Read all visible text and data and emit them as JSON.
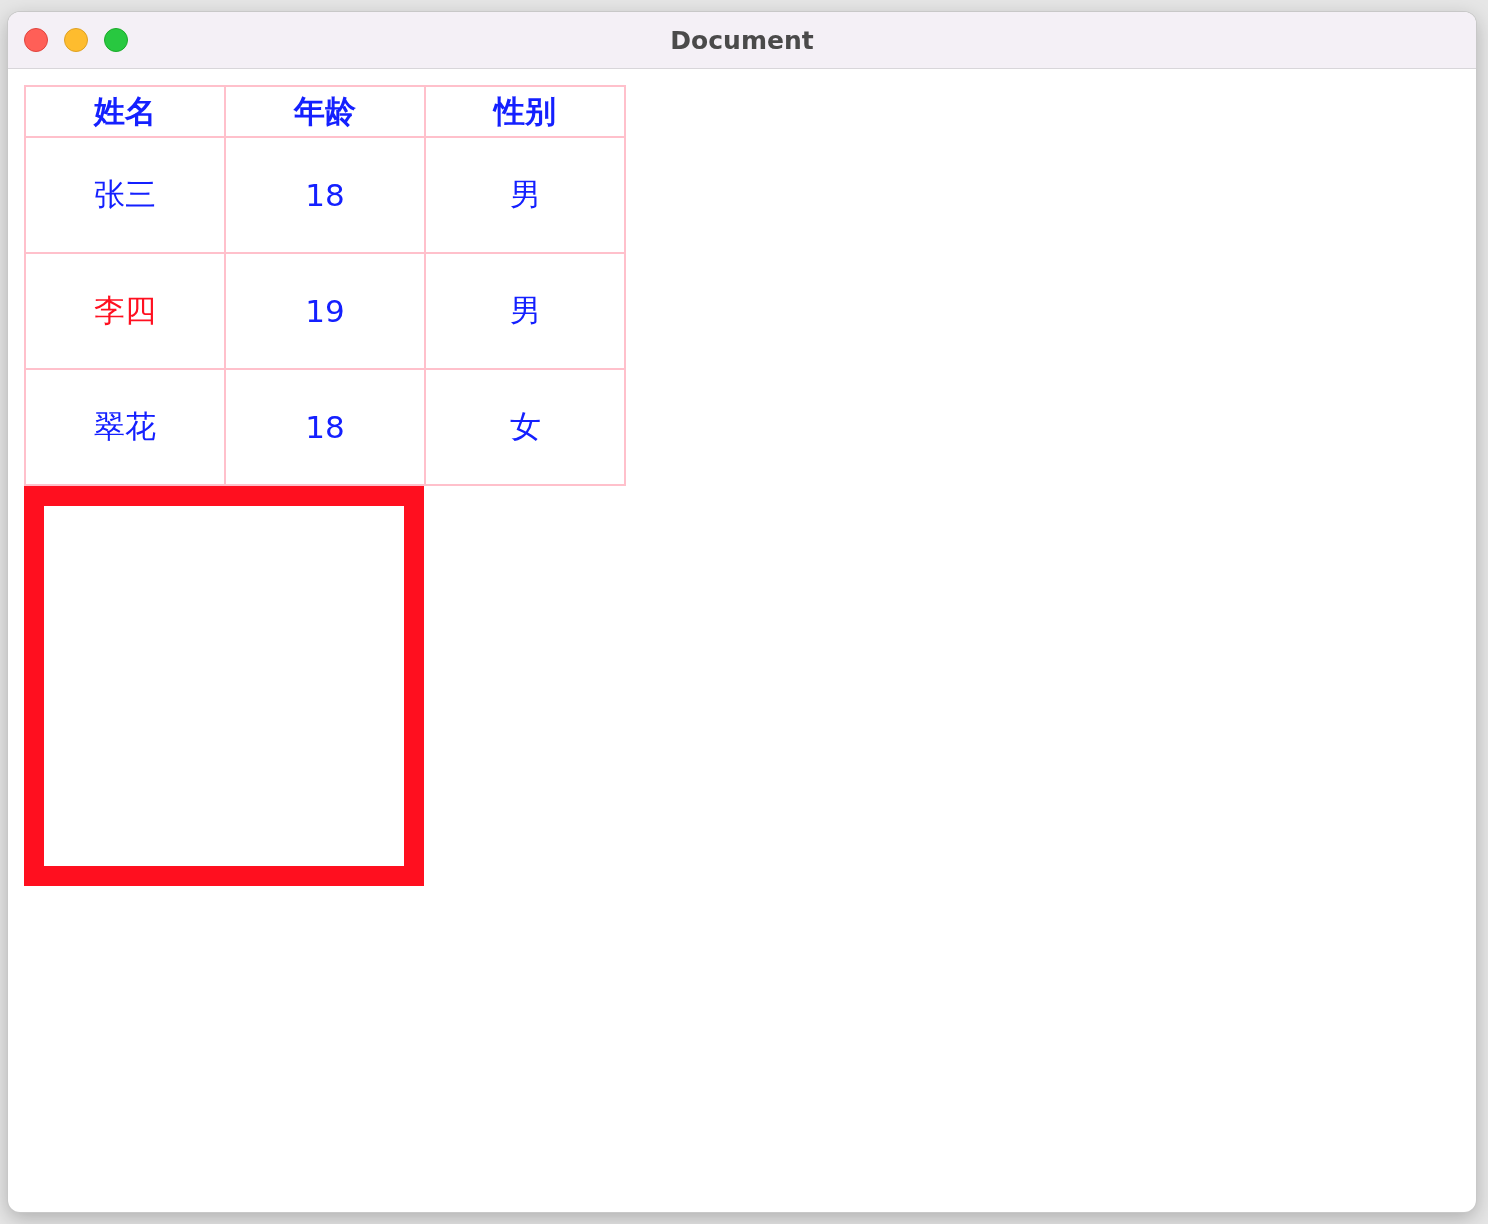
{
  "window": {
    "title": "Document"
  },
  "table": {
    "columns": [
      "姓名",
      "年龄",
      "性别"
    ],
    "rows": [
      {
        "name": {
          "text": "张三",
          "color": "#1420ff"
        },
        "age": "18",
        "gender": "男"
      },
      {
        "name": {
          "text": "李四",
          "color": "#ff1020"
        },
        "age": "19",
        "gender": "男"
      },
      {
        "name": {
          "text": "翠花",
          "color": "#1420ff"
        },
        "age": "18",
        "gender": "女"
      }
    ]
  },
  "box": {
    "kind": "frame"
  }
}
